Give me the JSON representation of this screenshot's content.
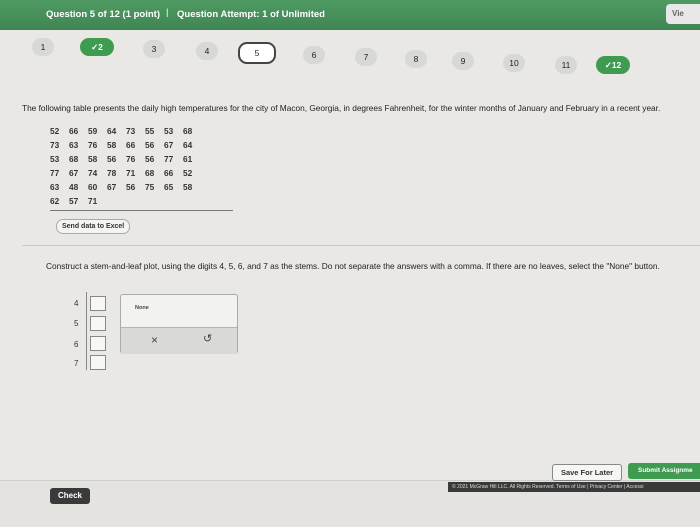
{
  "header": {
    "question_label": "Question 5 of 12 (1 point)",
    "separator": "|",
    "attempt_label": "Question Attempt: 1 of Unlimited",
    "right_tag": "Vie"
  },
  "nav": {
    "items": [
      {
        "label": "1",
        "state": "plain"
      },
      {
        "label": "✓2",
        "state": "done"
      },
      {
        "label": "3",
        "state": "plain"
      },
      {
        "label": "4",
        "state": "plain"
      },
      {
        "label": "5",
        "state": "current"
      },
      {
        "label": "6",
        "state": "plain"
      },
      {
        "label": "7",
        "state": "plain"
      },
      {
        "label": "8",
        "state": "plain"
      },
      {
        "label": "9",
        "state": "plain"
      },
      {
        "label": "10",
        "state": "plain"
      },
      {
        "label": "11",
        "state": "plain"
      },
      {
        "label": "✓12",
        "state": "done"
      }
    ]
  },
  "problem": {
    "prompt": "The following table presents the daily high temperatures for the city of Macon, Georgia, in degrees Fahrenheit, for the winter months of January and February in a recent year.",
    "table_rows": [
      [
        "52",
        "66",
        "59",
        "64",
        "73",
        "55",
        "53",
        "68"
      ],
      [
        "73",
        "63",
        "76",
        "58",
        "66",
        "56",
        "67",
        "64"
      ],
      [
        "53",
        "68",
        "58",
        "56",
        "76",
        "56",
        "77",
        "61"
      ],
      [
        "77",
        "67",
        "74",
        "78",
        "71",
        "68",
        "66",
        "52"
      ],
      [
        "63",
        "48",
        "60",
        "67",
        "56",
        "75",
        "65",
        "58"
      ],
      [
        "62",
        "57",
        "71"
      ]
    ],
    "excel_button": "Send data to Excel"
  },
  "task": {
    "instruction": "Construct a stem-and-leaf plot, using the digits 4, 5, 6, and 7 as the stems. Do not separate the answers with a comma. If there are no leaves, select the \"None\" button.",
    "stems": [
      "4",
      "5",
      "6",
      "7"
    ]
  },
  "tools": {
    "none_label": "None",
    "clear_symbol": "×",
    "undo_symbol": "↺"
  },
  "footer": {
    "check_label": "Check",
    "save_label": "Save For Later",
    "submit_label": "Submit Assignme",
    "copyright": "© 2021 McGraw Hill LLC. All Rights Reserved.  Terms of Use  |  Privacy Center  |  Accessi"
  },
  "colors": {
    "header_green": "#3f8553",
    "done_green": "#3f9b50"
  }
}
